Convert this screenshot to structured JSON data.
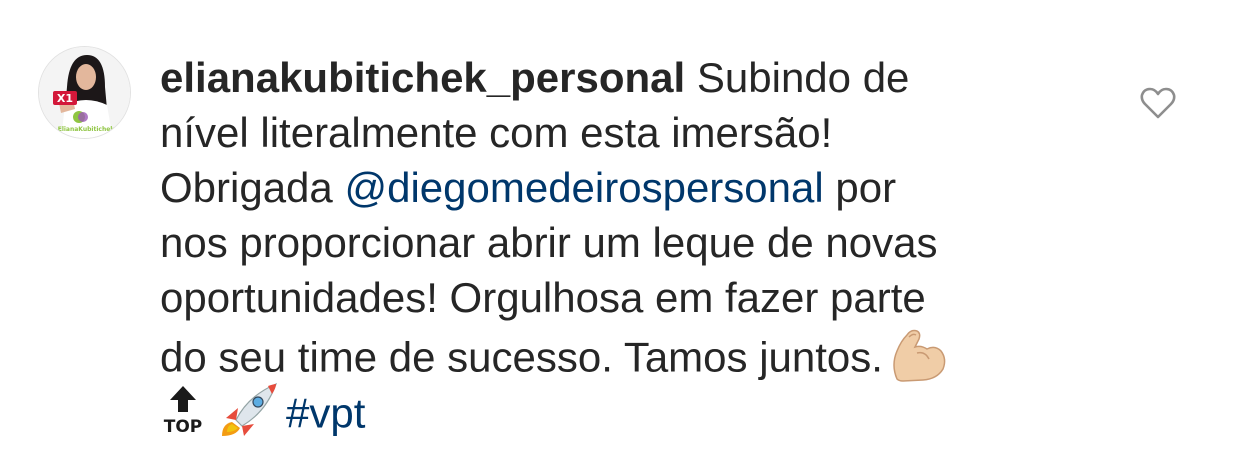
{
  "comment": {
    "username": "elianakubitichek_personal",
    "line1_text": " Subindo de",
    "line2": "nível literalmente com esta imersão!",
    "line3_before": "Obrigada ",
    "mention": "@diegomedeirospersonal",
    "line3_after": " por",
    "line4": "nos proporcionar abrir um leque de novas",
    "line5": "oportunidades! Orgulhosa em fazer parte",
    "line6": "do seu time de sucesso. Tamos juntos.",
    "hashtag": "#vpt",
    "emojis": [
      "flexed-biceps-icon",
      "top-arrow-icon",
      "rocket-icon"
    ],
    "top_label": "TOP"
  },
  "avatar": {
    "logo_text": "ElianaKubitichek"
  },
  "actions": {
    "like_icon": "heart-outline-icon"
  },
  "colors": {
    "text": "#262626",
    "link": "#00376b",
    "icon": "#8e8e8e"
  }
}
